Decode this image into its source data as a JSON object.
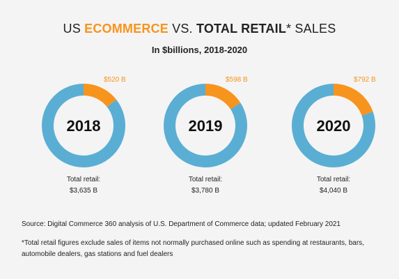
{
  "title": {
    "part1": "US ",
    "part2": "ECOMMERCE",
    "part3": " VS. ",
    "part4": "TOTAL RETAIL",
    "part5": "* SALES"
  },
  "subtitle": "In $billions, 2018-2020",
  "colors": {
    "ecommerce": "#f7941d",
    "other": "#5aaed3",
    "background": "#f4f4f4"
  },
  "chart_data": {
    "type": "pie",
    "title": "US ECOMMERCE VS. TOTAL RETAIL* SALES",
    "subtitle": "In $billions, 2018-2020",
    "charts": [
      {
        "year": "2018",
        "ecommerce": 520,
        "ecommerce_label": "$520 B",
        "total": 3635,
        "total_label": "Total retail:",
        "total_value": "$3,635 B"
      },
      {
        "year": "2019",
        "ecommerce": 598,
        "ecommerce_label": "$598 B",
        "total": 3780,
        "total_label": "Total retail:",
        "total_value": "$3,780 B"
      },
      {
        "year": "2020",
        "ecommerce": 792,
        "ecommerce_label": "$792 B",
        "total": 4040,
        "total_label": "Total retail:",
        "total_value": "$4,040 B"
      }
    ]
  },
  "source": "Source: Digital Commerce 360 analysis of U.S. Department of Commerce data; updated February 2021",
  "footnote": "*Total retail figures exclude sales of items not normally purchased online such as spending at restaurants, bars, automobile dealers, gas stations and fuel dealers"
}
